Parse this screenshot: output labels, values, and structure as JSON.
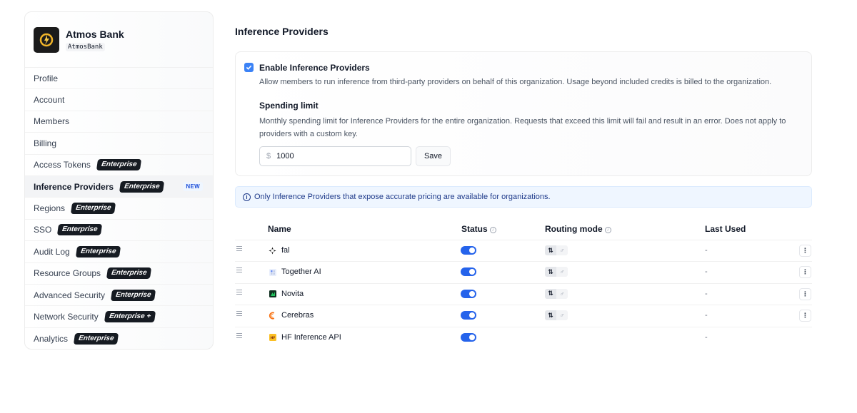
{
  "org": {
    "name": "Atmos Bank",
    "handle": "AtmosBank"
  },
  "sidebar": {
    "items": [
      {
        "label": "Profile",
        "badge": ""
      },
      {
        "label": "Account",
        "badge": ""
      },
      {
        "label": "Members",
        "badge": ""
      },
      {
        "label": "Billing",
        "badge": ""
      },
      {
        "label": "Access Tokens",
        "badge": "Enterprise"
      },
      {
        "label": "Inference Providers",
        "badge": "Enterprise",
        "new": "NEW",
        "active": true
      },
      {
        "label": "Regions",
        "badge": "Enterprise"
      },
      {
        "label": "SSO",
        "badge": "Enterprise"
      },
      {
        "label": "Audit Log",
        "badge": "Enterprise"
      },
      {
        "label": "Resource Groups",
        "badge": "Enterprise"
      },
      {
        "label": "Advanced Security",
        "badge": "Enterprise"
      },
      {
        "label": "Network Security",
        "badge": "Enterprise +"
      },
      {
        "label": "Analytics",
        "badge": "Enterprise"
      }
    ]
  },
  "main": {
    "title": "Inference Providers",
    "enable": {
      "checked": true,
      "title": "Enable Inference Providers",
      "description": "Allow members to run inference from third-party providers on behalf of this organization. Usage beyond included credits is billed to the organization."
    },
    "spending": {
      "title": "Spending limit",
      "description": "Monthly spending limit for Inference Providers for the entire organization. Requests that exceed this limit will fail and result in an error. Does not apply to providers with a custom key.",
      "currency": "$",
      "value": "1000",
      "save_label": "Save"
    },
    "info": "Only Inference Providers that expose accurate pricing are available for organizations.",
    "table": {
      "headers": {
        "name": "Name",
        "status": "Status",
        "routing": "Routing mode",
        "last_used": "Last Used"
      },
      "rows": [
        {
          "name": "fal",
          "icon": "fal-logo-icon",
          "enabled": true,
          "routing": true,
          "last_used": "-"
        },
        {
          "name": "Together AI",
          "icon": "together-logo-icon",
          "enabled": true,
          "routing": true,
          "last_used": "-"
        },
        {
          "name": "Novita",
          "icon": "novita-logo-icon",
          "enabled": true,
          "routing": true,
          "last_used": "-"
        },
        {
          "name": "Cerebras",
          "icon": "cerebras-logo-icon",
          "enabled": true,
          "routing": true,
          "last_used": "-"
        },
        {
          "name": "HF Inference API",
          "icon": "hf-logo-icon",
          "enabled": true,
          "routing": false,
          "last_used": "-"
        }
      ]
    }
  },
  "colors": {
    "accent": "#2563eb",
    "badge_bg": "#161b22",
    "info_bg": "#eff6ff"
  }
}
